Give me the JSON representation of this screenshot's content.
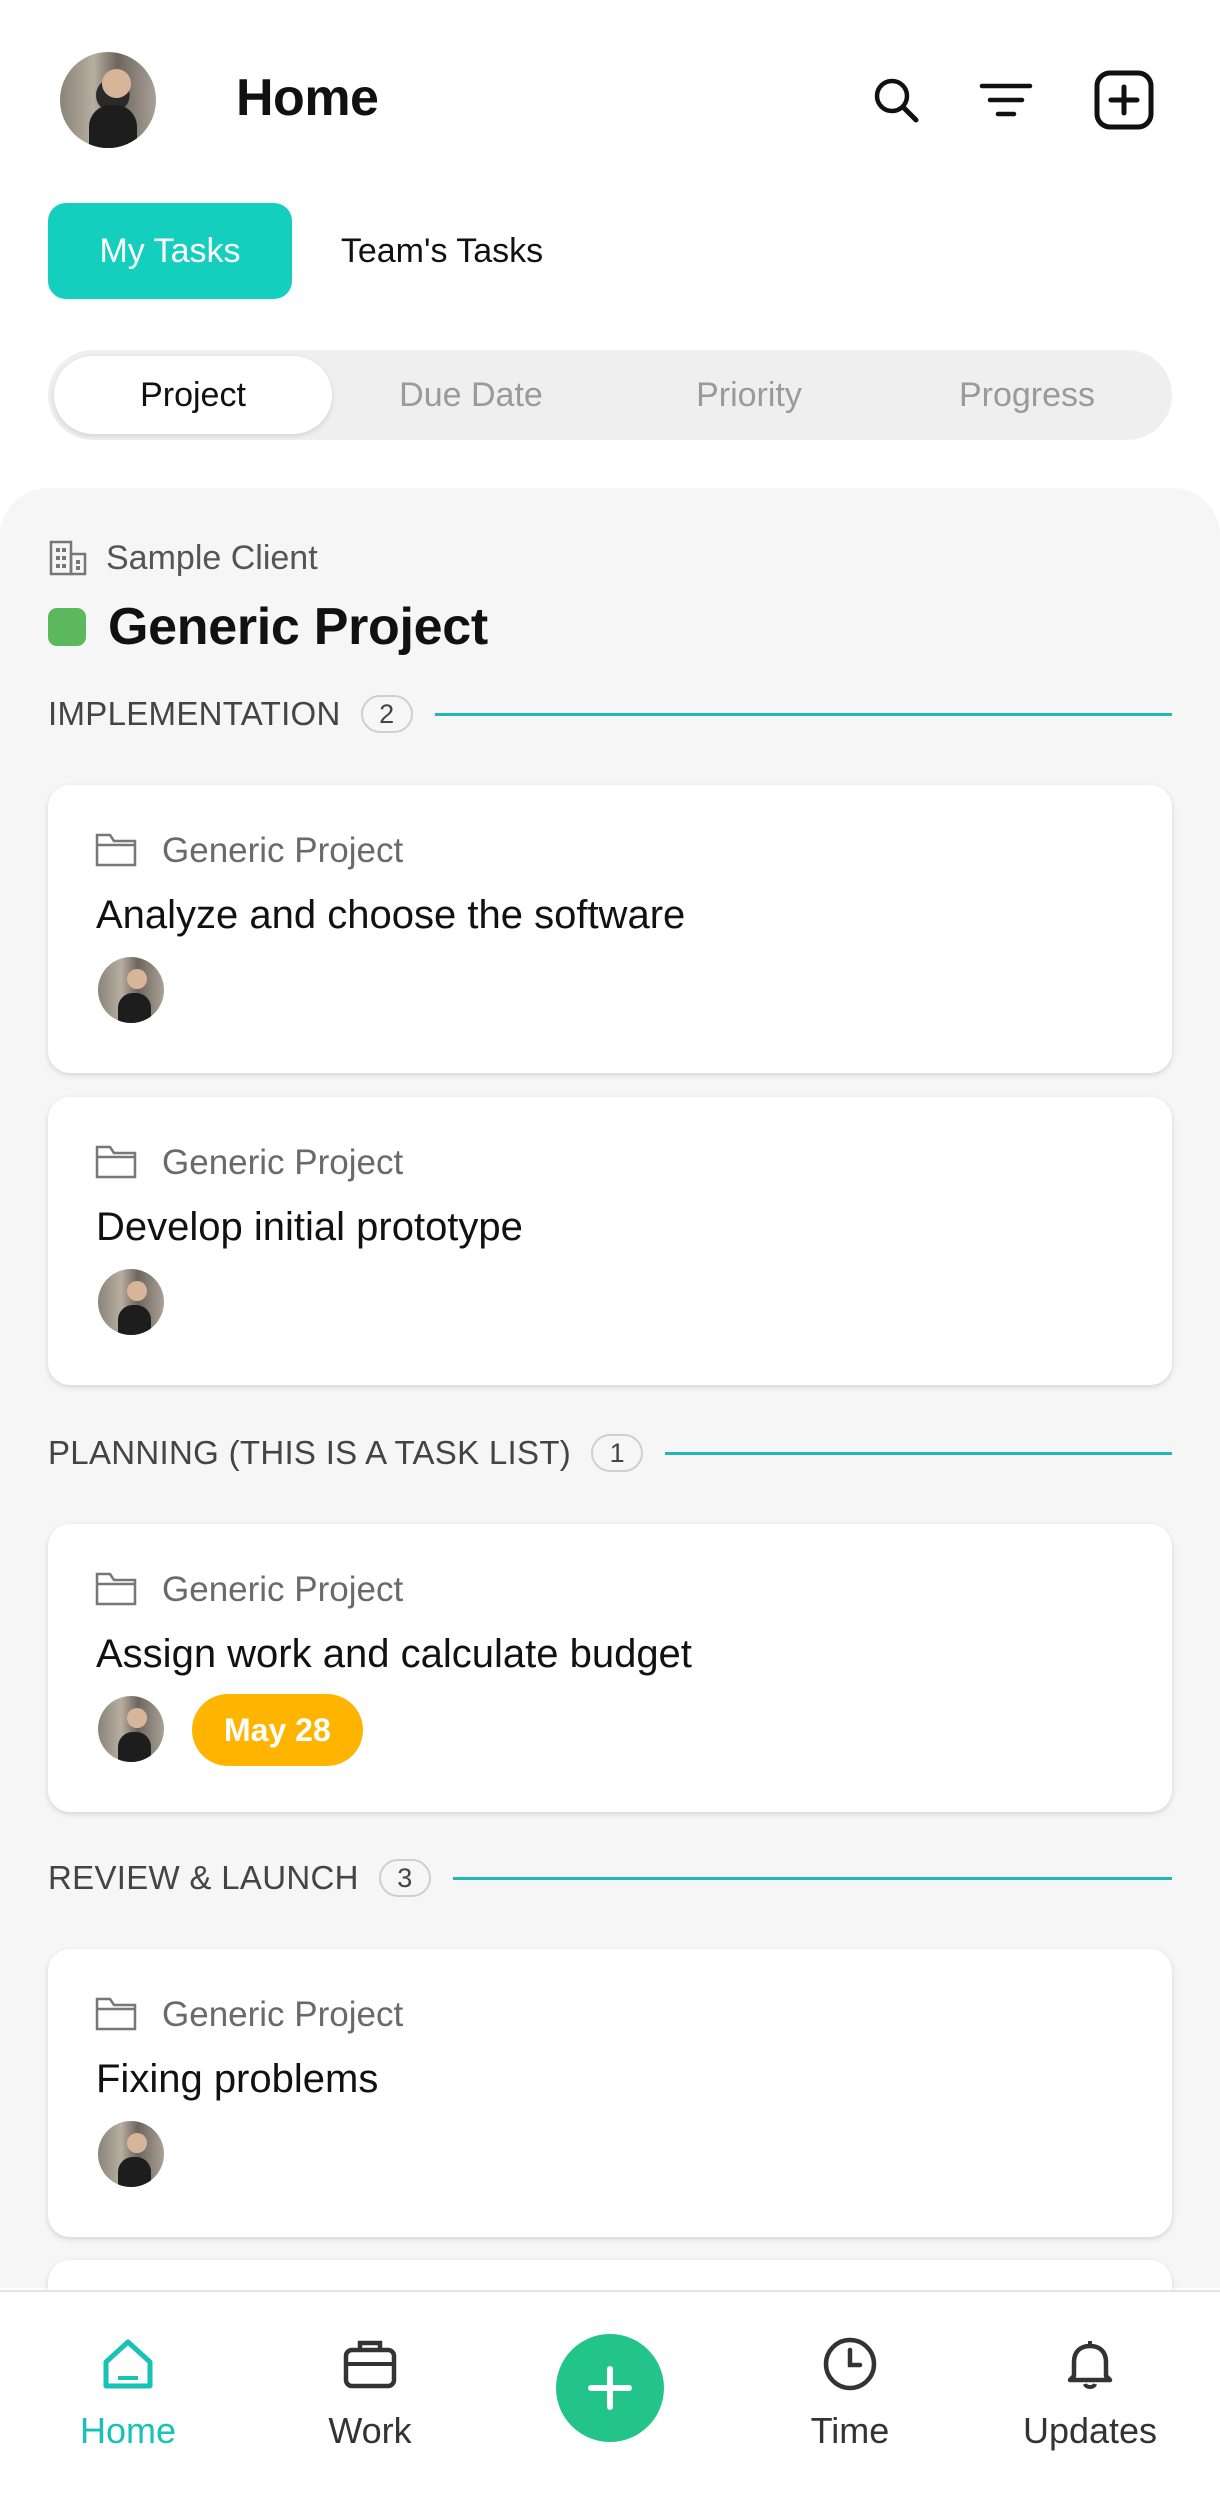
{
  "header": {
    "title": "Home",
    "icons": [
      "search-icon",
      "filter-icon",
      "add-square-icon"
    ]
  },
  "task_tabs": {
    "mine": "My Tasks",
    "team": "Team's Tasks"
  },
  "group_by": {
    "options": [
      "Project",
      "Due Date",
      "Priority",
      "Progress"
    ],
    "selected": "Project"
  },
  "client": "Sample Client",
  "project": {
    "name": "Generic Project",
    "color": "#5cb85c"
  },
  "sections": [
    {
      "name": "IMPLEMENTATION",
      "count": "2",
      "tasks": [
        {
          "project": "Generic Project",
          "title": "Analyze and choose the software"
        },
        {
          "project": "Generic Project",
          "title": "Develop initial prototype"
        }
      ]
    },
    {
      "name": "PLANNING (THIS IS A TASK LIST)",
      "count": "1",
      "tasks": [
        {
          "project": "Generic Project",
          "title": "Assign work and calculate budget",
          "due": "May 28"
        }
      ]
    },
    {
      "name": "REVIEW & LAUNCH",
      "count": "3",
      "tasks": [
        {
          "project": "Generic Project",
          "title": "Fixing problems"
        }
      ]
    }
  ],
  "bottom_nav": {
    "home": "Home",
    "work": "Work",
    "time": "Time",
    "updates": "Updates"
  },
  "colors": {
    "accent": "#14cfbe",
    "due_badge": "#ffb400",
    "fab": "#22c48a",
    "section_line": "#20b8b0"
  }
}
